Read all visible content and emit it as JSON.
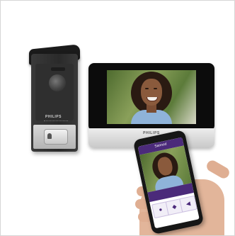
{
  "scene": {
    "door_station": {
      "brand": "PHILIPS"
    },
    "monitor": {
      "brand": "PHILIPS"
    },
    "phone_app": {
      "title": "Sannod"
    },
    "colors": {
      "app_purple": "#4b2a7a",
      "background": "#ffffff"
    }
  }
}
